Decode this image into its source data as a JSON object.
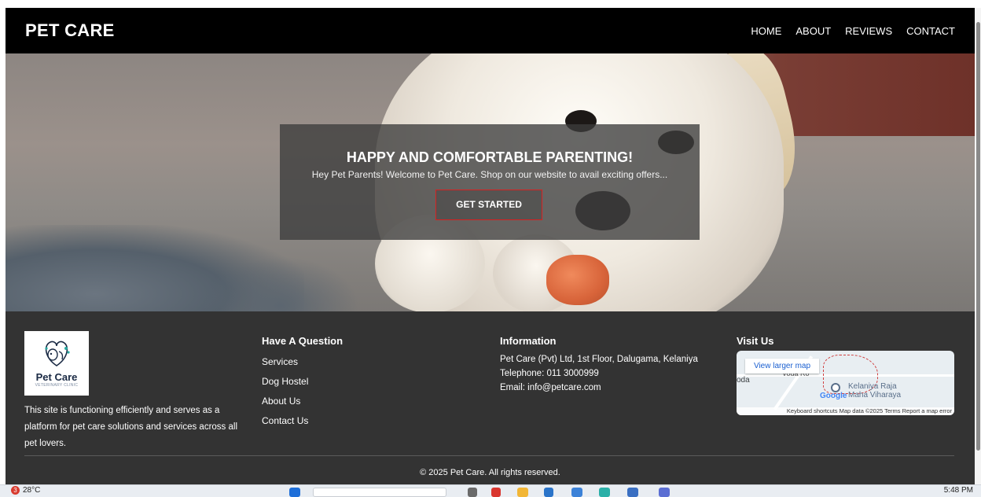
{
  "header": {
    "brand": "PET CARE",
    "nav": [
      "HOME",
      "ABOUT",
      "REVIEWS",
      "CONTACT"
    ]
  },
  "hero": {
    "title": "HAPPY AND COMFORTABLE PARENTING!",
    "subtitle": "Hey Pet Parents! Welcome to Pet Care. Shop on our website to avail exciting offers...",
    "cta_label": "GET STARTED"
  },
  "footer": {
    "logo_text": "Pet Care",
    "logo_tagline": "VETERINARY CLINIC",
    "about": "This site is functioning efficiently and serves as a platform for pet care solutions and services across all pet lovers.",
    "question_title": "Have A Question",
    "links": [
      "Services",
      "Dog Hostel",
      "About Us",
      "Contact Us"
    ],
    "info_title": "Information",
    "info": [
      "Pet Care (Pvt) Ltd, 1st Floor, Dalugama, Kelaniya",
      "Telephone: 011 3000999",
      "Email: info@petcare.com"
    ],
    "visit_title": "Visit Us",
    "map": {
      "button": "View larger map",
      "label_left": "oda",
      "label_top": "Voda Ro",
      "place_line1": "Kelaniya Raja",
      "place_line2": "Maha Viharaya",
      "google": "Google",
      "bar": "Keyboard shortcuts   Map data ©2025   Terms   Report a map error"
    },
    "copyright": "© 2025 Pet Care. All rights reserved."
  },
  "taskbar": {
    "weather_badge": "3",
    "weather": "28°C",
    "clock": "5:48 PM"
  },
  "colors": {
    "header_bg": "#000000",
    "footer_bg": "#333333",
    "cta_border": "#d82020"
  }
}
